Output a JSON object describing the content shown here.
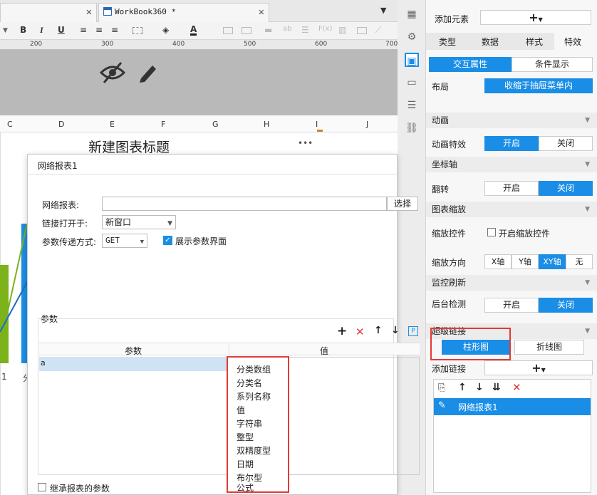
{
  "tabs": [
    {
      "label": "WorkBook360 *"
    }
  ],
  "toolbar": {
    "bold": "B",
    "italic": "I",
    "underline": "U",
    "font_color": "A",
    "text_ab": "ab",
    "formula": "F(x)"
  },
  "ruler": {
    "marks": [
      "200",
      "300",
      "400",
      "500",
      "600",
      "700"
    ]
  },
  "columns": [
    "C",
    "D",
    "E",
    "F",
    "G",
    "H",
    "I",
    "J"
  ],
  "canvas": {
    "chart_title": "新建图表标题",
    "more": "•••",
    "axis_labels": [
      "1",
      "分"
    ]
  },
  "dialog": {
    "title": "网络报表1",
    "url_label": "网络报表:",
    "url_value": "",
    "select_button": "选择",
    "open_label": "链接打开于:",
    "open_value": "新窗口",
    "method_label": "参数传递方式:",
    "method_value": "GET",
    "show_params_label": "展示参数界面",
    "params_section": "参数",
    "col_param": "参数",
    "col_value": "值",
    "row_param": "a",
    "inherit_label": "继承报表的参数",
    "p_badge": "P"
  },
  "dropdown_options": [
    "分类数组",
    "分类名",
    "系列名称",
    "值",
    "字符串",
    "整型",
    "双精度型",
    "日期",
    "布尔型",
    "公式"
  ],
  "panel": {
    "add_element_label": "添加元素",
    "add_symbol": "+",
    "tabs": [
      "类型",
      "数据",
      "样式",
      "特效"
    ],
    "subtabs": [
      "交互属性",
      "条件显示"
    ],
    "layout_label": "布局",
    "layout_value": "收缩于抽屉菜单内",
    "animation_header": "动画",
    "animation_label": "动画特效",
    "on": "开启",
    "off": "关闭",
    "axis_header": "坐标轴",
    "flip_label": "翻转",
    "zoom_header": "图表缩放",
    "zoom_ctrl_label": "缩放控件",
    "zoom_ctrl_check": "开启缩放控件",
    "zoom_dir_label": "缩放方向",
    "zoom_dirs": [
      "X轴",
      "Y轴",
      "XY轴",
      "无"
    ],
    "monitor_header": "监控刷新",
    "backend_label": "后台检测",
    "hyperlink_header": "超级链接",
    "hyperlink_tabs": [
      "柱形图",
      "折线图"
    ],
    "add_link_label": "添加链接",
    "link_item": "网络报表1"
  }
}
